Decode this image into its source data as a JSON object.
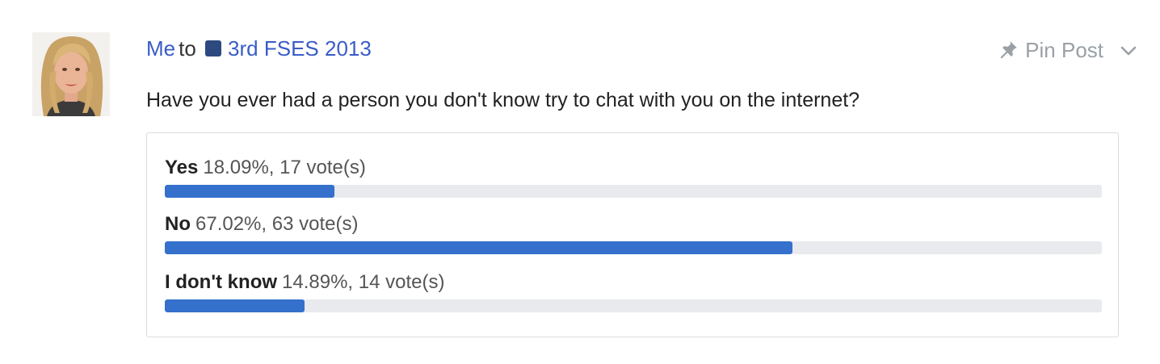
{
  "post": {
    "author": "Me",
    "to_text": "to",
    "group": {
      "name": "3rd FSES 2013",
      "color": "#2c4a80"
    },
    "pin_label": "Pin Post",
    "question": "Have you ever had a person you don't know try to chat with you on the internet?",
    "accent_color": "#3470cc",
    "link_color": "#3a5cc7",
    "icons": {
      "pin": "pushpin-icon",
      "menu": "chevron-down-icon",
      "group": "group-square-icon"
    }
  },
  "poll": {
    "options": [
      {
        "label": "Yes",
        "stats": "18.09%, 17 vote(s)",
        "percent": 18.09,
        "votes": 17
      },
      {
        "label": "No",
        "stats": "67.02%, 63 vote(s)",
        "percent": 67.02,
        "votes": 63
      },
      {
        "label": "I don't know",
        "stats": "14.89%, 14 vote(s)",
        "percent": 14.89,
        "votes": 14
      }
    ]
  }
}
